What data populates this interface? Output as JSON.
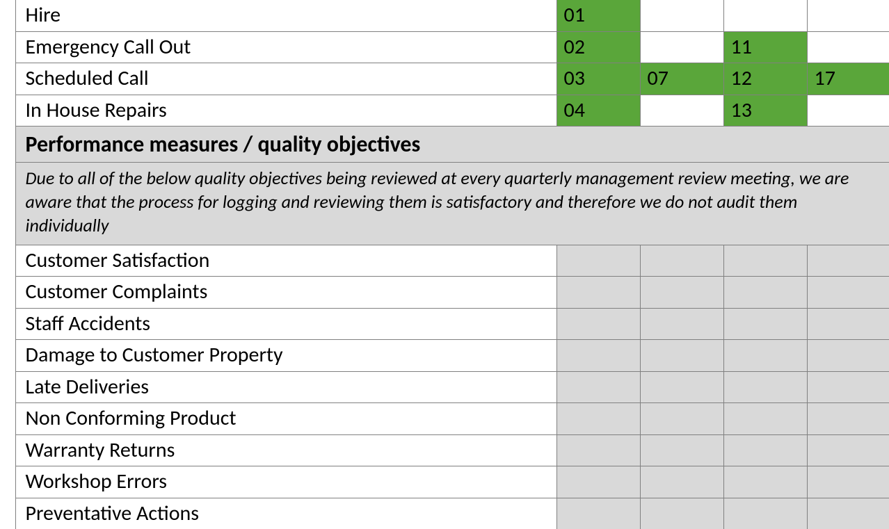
{
  "processRows": [
    {
      "label": "Hire",
      "cells": [
        {
          "v": "01",
          "g": true
        },
        {
          "v": "",
          "g": false
        },
        {
          "v": "",
          "g": false
        },
        {
          "v": "",
          "g": false
        }
      ]
    },
    {
      "label": "Emergency Call Out",
      "cells": [
        {
          "v": "02",
          "g": true
        },
        {
          "v": "",
          "g": false
        },
        {
          "v": "11",
          "g": true
        },
        {
          "v": "",
          "g": false
        }
      ]
    },
    {
      "label": "Scheduled Call",
      "cells": [
        {
          "v": "03",
          "g": true
        },
        {
          "v": "07",
          "g": true
        },
        {
          "v": "12",
          "g": true
        },
        {
          "v": "17",
          "g": true
        }
      ]
    },
    {
      "label": "In House Repairs",
      "cells": [
        {
          "v": "04",
          "g": true
        },
        {
          "v": "",
          "g": false
        },
        {
          "v": "13",
          "g": true
        },
        {
          "v": "",
          "g": false
        }
      ]
    }
  ],
  "section": {
    "title": "Performance measures / quality objectives",
    "note": "Due to all of the below quality objectives being reviewed at every quarterly management review meeting, we are aware that the process for logging and reviewing them is satisfactory and therefore we do not audit them individually"
  },
  "measureRows": [
    "Customer Satisfaction",
    "Customer Complaints",
    "Staff Accidents",
    "Damage to Customer Property",
    "Late Deliveries",
    "Non Conforming Product",
    "Warranty Returns",
    "Workshop Errors",
    "Preventative Actions"
  ]
}
